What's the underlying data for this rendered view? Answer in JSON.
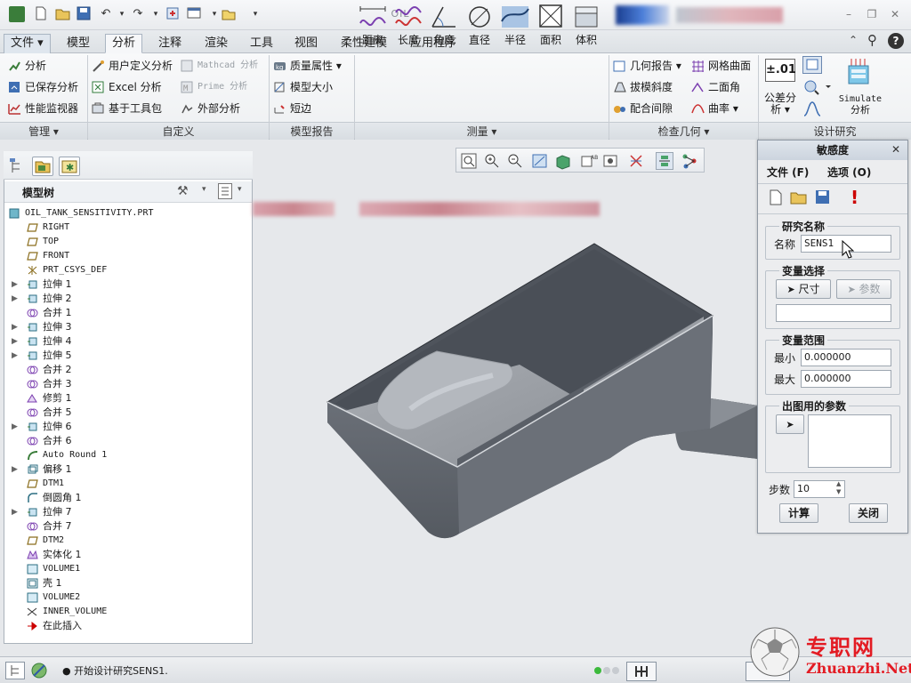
{
  "window": {
    "title": "OIL"
  },
  "menubar": {
    "tabs": [
      "文件",
      "模型",
      "分析",
      "注释",
      "渲染",
      "工具",
      "视图",
      "柔性建模",
      "应用程序"
    ],
    "active": "分析"
  },
  "ribbon": {
    "manage": {
      "analysis": "分析",
      "saved_analysis": "已保存分析",
      "perf_monitor": "性能监视器"
    },
    "custom": {
      "user_defined": "用户定义分析",
      "excel": "Excel 分析",
      "toolkit": "基于工具包",
      "mathcad": "Mathcad 分析",
      "prime": "Prime 分析",
      "external": "外部分析"
    },
    "model_report": {
      "mass_props": "质量属性",
      "model_size": "模型大小",
      "short_edge": "短边"
    },
    "measure": {
      "distance": "距离",
      "length": "长度",
      "angle": "角度",
      "diameter": "直径",
      "radius": "半径",
      "area": "面积",
      "volume": "体积"
    },
    "inspect": {
      "geo_report": "几何报告",
      "draft": "拔模斜度",
      "clearance": "配合间隙",
      "mesh": "网格曲面",
      "dihedral": "二面角",
      "curvature": "曲率"
    },
    "design": {
      "tolerance": "公差分",
      "tolerance2": "析",
      "tol_value": "±.01",
      "simulate": "Simulate",
      "simulate2": "分析"
    },
    "groups": {
      "manage": "管理",
      "custom": "自定义",
      "model_report": "模型报告",
      "measure": "测量",
      "inspect": "检查几何",
      "design": "设计研究"
    }
  },
  "model_tree": {
    "title": "模型树",
    "items": [
      {
        "label": "OIL_TANK_SENSITIVITY.PRT",
        "icon": "part-icon",
        "expandable": false
      },
      {
        "label": "RIGHT",
        "icon": "datum-plane-icon",
        "expandable": false
      },
      {
        "label": "TOP",
        "icon": "datum-plane-icon",
        "expandable": false
      },
      {
        "label": "FRONT",
        "icon": "datum-plane-icon",
        "expandable": false
      },
      {
        "label": "PRT_CSYS_DEF",
        "icon": "csys-icon",
        "expandable": false
      },
      {
        "label": "拉伸 1",
        "icon": "extrude-icon",
        "expandable": true
      },
      {
        "label": "拉伸 2",
        "icon": "extrude-icon",
        "expandable": true
      },
      {
        "label": "合并 1",
        "icon": "merge-icon",
        "expandable": false
      },
      {
        "label": "拉伸 3",
        "icon": "extrude-icon",
        "expandable": true
      },
      {
        "label": "拉伸 4",
        "icon": "extrude-icon",
        "expandable": true
      },
      {
        "label": "拉伸 5",
        "icon": "extrude-icon",
        "expandable": true
      },
      {
        "label": "合并 2",
        "icon": "merge-icon",
        "expandable": false
      },
      {
        "label": "合并 3",
        "icon": "merge-icon",
        "expandable": false
      },
      {
        "label": "修剪 1",
        "icon": "trim-icon",
        "expandable": false
      },
      {
        "label": "合并 5",
        "icon": "merge-icon",
        "expandable": false
      },
      {
        "label": "拉伸 6",
        "icon": "extrude-icon",
        "expandable": true
      },
      {
        "label": "合并 6",
        "icon": "merge-icon",
        "expandable": false
      },
      {
        "label": "Auto Round 1",
        "icon": "auto-round-icon",
        "expandable": false
      },
      {
        "label": "偏移 1",
        "icon": "offset-icon",
        "expandable": true
      },
      {
        "label": "DTM1",
        "icon": "datum-plane-icon",
        "expandable": false
      },
      {
        "label": "倒圆角 1",
        "icon": "round-icon",
        "expandable": false
      },
      {
        "label": "拉伸 7",
        "icon": "extrude-icon",
        "expandable": true
      },
      {
        "label": "合并 7",
        "icon": "merge-icon",
        "expandable": false
      },
      {
        "label": "DTM2",
        "icon": "datum-plane-icon",
        "expandable": false
      },
      {
        "label": "实体化 1",
        "icon": "solidify-icon",
        "expandable": false
      },
      {
        "label": "VOLUME1",
        "icon": "analysis-feature-icon",
        "expandable": false
      },
      {
        "label": "壳 1",
        "icon": "shell-icon",
        "expandable": false
      },
      {
        "label": "VOLUME2",
        "icon": "analysis-feature-icon",
        "expandable": false
      },
      {
        "label": "INNER_VOLUME",
        "icon": "parameter-icon",
        "expandable": false
      },
      {
        "label": "在此插入",
        "icon": "insert-here-icon",
        "expandable": false
      }
    ]
  },
  "sensitivity": {
    "title": "敏感度",
    "menu_file": "文件 (F)",
    "menu_options": "选项 (O)",
    "study_name_legend": "研究名称",
    "name_label": "名称",
    "name_value": "SENS1",
    "variable_legend": "变量选择",
    "dim_button": "尺寸",
    "param_button": "参数",
    "variable_value": "",
    "range_legend": "变量范围",
    "min_label": "最小",
    "min_value": "0.000000",
    "max_label": "最大",
    "max_value": "0.000000",
    "plot_params_legend": "出图用的参数",
    "steps_label": "步数",
    "steps_value": "10",
    "compute_button": "计算",
    "close_button": "关闭"
  },
  "status": {
    "message": "● 开始设计研究SENS1."
  },
  "watermark": {
    "text_cn": "专职网",
    "text_url": "Zhuanzhi.Net"
  },
  "colors": {
    "accent": "#d4a017",
    "error": "#cc0000",
    "part": "#5a5e66"
  }
}
